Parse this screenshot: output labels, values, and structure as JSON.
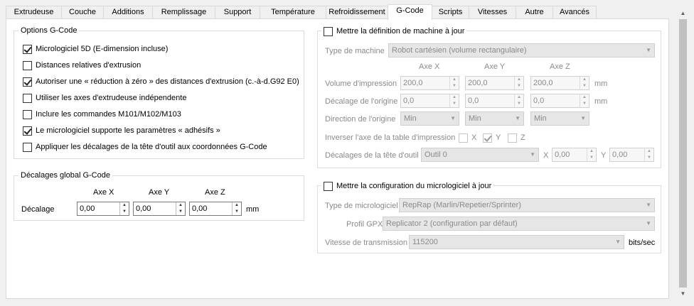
{
  "tabs": [
    {
      "label": "Extrudeuse",
      "active": false
    },
    {
      "label": "Couche",
      "active": false
    },
    {
      "label": "Additions",
      "active": false
    },
    {
      "label": "Remplissage",
      "active": false
    },
    {
      "label": "Support",
      "active": false
    },
    {
      "label": "Température",
      "active": false
    },
    {
      "label": "Refroidissement",
      "active": false
    },
    {
      "label": "G-Code",
      "active": true
    },
    {
      "label": "Scripts",
      "active": false
    },
    {
      "label": "Vitesses",
      "active": false
    },
    {
      "label": "Autre",
      "active": false
    },
    {
      "label": "Avancés",
      "active": false
    }
  ],
  "gcode_options": {
    "title": "Options G-Code",
    "items": [
      {
        "label": "Micrologiciel 5D (E-dimension incluse)",
        "checked": true
      },
      {
        "label": "Distances relatives d'extrusion",
        "checked": false
      },
      {
        "label": "Autoriser une « réduction à zéro » des distances d'extrusion (c.-à-d.G92 E0)",
        "checked": true
      },
      {
        "label": "Utiliser les axes d'extrudeuse indépendente",
        "checked": false
      },
      {
        "label": "Inclure les commandes M101/M102/M103",
        "checked": false
      },
      {
        "label": "Le micrologiciel supporte les paramètres « adhésifs »",
        "checked": true
      },
      {
        "label": "Appliquer les décalages de la tête d'outil aux coordonnées G-Code",
        "checked": false
      }
    ]
  },
  "global_offsets": {
    "title": "Décalages global G-Code",
    "axis_x": "Axe X",
    "axis_y": "Axe Y",
    "axis_z": "Axe Z",
    "row_label": "Décalage",
    "x": "0,00",
    "y": "0,00",
    "z": "0,00",
    "unit": "mm"
  },
  "machine": {
    "title": "Mettre la définition de machine à jour",
    "checked": false,
    "type_label": "Type de machine",
    "type_value": "Robot cartésien (volume rectangulaire)",
    "axis_x": "Axe X",
    "axis_y": "Axe Y",
    "axis_z": "Axe Z",
    "volume_label": "Volume d'impression",
    "volume": [
      "200,0",
      "200,0",
      "200,0"
    ],
    "origin_offset_label": "Décalage de l'origine",
    "origin_offset": [
      "0,0",
      "0,0",
      "0,0"
    ],
    "unit": "mm",
    "origin_dir_label": "Direction de l'origine",
    "origin_dir": [
      "Min",
      "Min",
      "Min"
    ],
    "invert_label": "Inverser l'axe de la table d'impression",
    "invert": [
      {
        "label": "X",
        "checked": false
      },
      {
        "label": "Y",
        "checked": true
      },
      {
        "label": "Z",
        "checked": false
      }
    ],
    "tool_offsets_label": "Décalages de la tête d'outil",
    "tool_value": "Outil 0",
    "tool_x_label": "X",
    "tool_x": "0,00",
    "tool_y_label": "Y",
    "tool_y": "0,00"
  },
  "firmware": {
    "title": "Mettre la configuration du micrologiciel à jour",
    "checked": false,
    "type_label": "Type de micrologiciel",
    "type_value": "RepRap (Marlin/Repetier/Sprinter)",
    "gpx_label": "Profil GPX",
    "gpx_value": "Replicator 2 (configuration par défaut)",
    "baud_label": "Vitesse de transmission",
    "baud_value": "115200",
    "baud_unit": "bits/sec"
  },
  "icons": {
    "spin_up": "▲",
    "spin_down": "▼",
    "combo_arrow": "▼",
    "scroll_up": "▲",
    "scroll_down": "▼"
  }
}
